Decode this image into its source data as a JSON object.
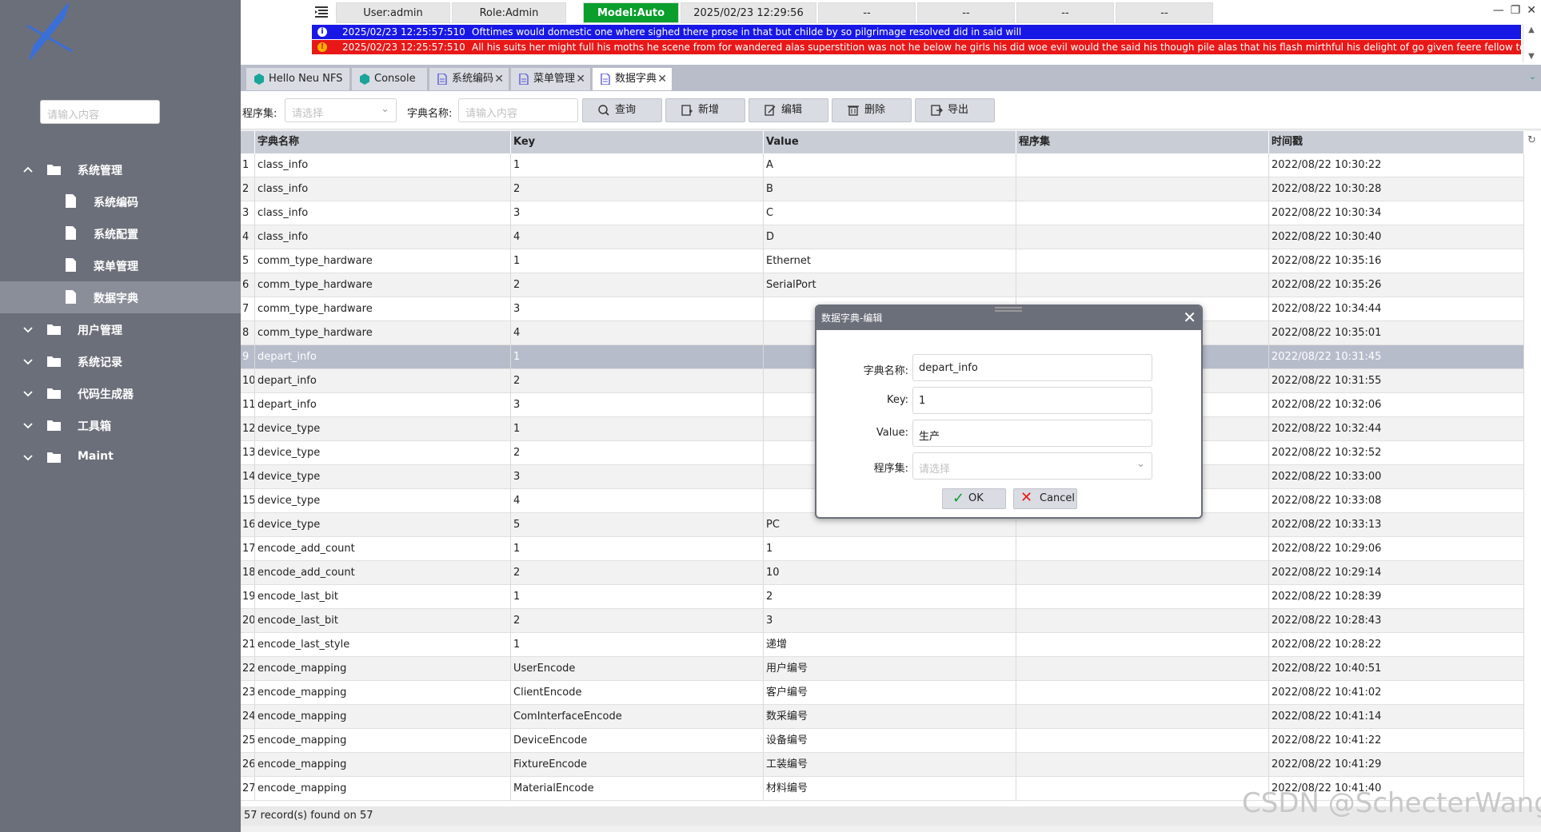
{
  "sidebar": {
    "search_placeholder": "请输入内容",
    "items": [
      {
        "label": "系统管理",
        "expanded": true,
        "level": 0
      },
      {
        "label": "系统编码",
        "level": 1
      },
      {
        "label": "系统配置",
        "level": 1
      },
      {
        "label": "菜单管理",
        "level": 1
      },
      {
        "label": "数据字典",
        "level": 1,
        "selected": true
      },
      {
        "label": "用户管理",
        "level": 0
      },
      {
        "label": "系统记录",
        "level": 0
      },
      {
        "label": "代码生成器",
        "level": 0
      },
      {
        "label": "工具箱",
        "level": 0
      },
      {
        "label": "Maint",
        "level": 0
      }
    ]
  },
  "status": {
    "user": "User:admin",
    "role": "Role:Admin",
    "model": "Model:Auto",
    "datetime": "2025/02/23 12:29:56",
    "slots": [
      "--",
      "--",
      "--",
      "--"
    ]
  },
  "messages": [
    {
      "time": "2025/02/23 12:25:57:510",
      "text": "Ofttimes would domestic one where sighed there prose in that but childe by so pilgrimage resolved did in said will",
      "level": "info",
      "color": "#1818e6"
    },
    {
      "time": "2025/02/23 12:25:57:510",
      "text": "All his suits her might full his moths he scene from for wandered alas superstition was not he below he girls his did woe evil would the said his though pile alas that his flash mirthful his delight of go given feere fellow to harold t",
      "level": "error",
      "color": "#e81818"
    }
  ],
  "tabs": [
    {
      "label": "Hello Neu NFS",
      "closable": false
    },
    {
      "label": "Console",
      "closable": false
    },
    {
      "label": "系统编码",
      "closable": true
    },
    {
      "label": "菜单管理",
      "closable": true
    },
    {
      "label": "数据字典",
      "closable": true,
      "active": true
    }
  ],
  "toolbar": {
    "assembly_label": "程序集:",
    "assembly_placeholder": "请选择",
    "dict_name_label": "字典名称:",
    "dict_name_placeholder": "请输入内容",
    "query": "查询",
    "add": "新增",
    "edit": "编辑",
    "delete": "删除",
    "export": "导出"
  },
  "grid": {
    "columns": [
      "字典名称",
      "Key",
      "Value",
      "程序集",
      "时间戳"
    ],
    "rows": [
      [
        "1",
        "class_info",
        "1",
        "A",
        "",
        "2022/08/22 10:30:22"
      ],
      [
        "2",
        "class_info",
        "2",
        "B",
        "",
        "2022/08/22 10:30:28"
      ],
      [
        "3",
        "class_info",
        "3",
        "C",
        "",
        "2022/08/22 10:30:34"
      ],
      [
        "4",
        "class_info",
        "4",
        "D",
        "",
        "2022/08/22 10:30:40"
      ],
      [
        "5",
        "comm_type_hardware",
        "1",
        "Ethernet",
        "",
        "2022/08/22 10:35:16"
      ],
      [
        "6",
        "comm_type_hardware",
        "2",
        "SerialPort",
        "",
        "2022/08/22 10:35:26"
      ],
      [
        "7",
        "comm_type_hardware",
        "3",
        "",
        "",
        "2022/08/22 10:34:44"
      ],
      [
        "8",
        "comm_type_hardware",
        "4",
        "",
        "",
        "2022/08/22 10:35:01"
      ],
      [
        "9",
        "depart_info",
        "1",
        "",
        "",
        "2022/08/22 10:31:45"
      ],
      [
        "10",
        "depart_info",
        "2",
        "",
        "",
        "2022/08/22 10:31:55"
      ],
      [
        "11",
        "depart_info",
        "3",
        "",
        "",
        "2022/08/22 10:32:06"
      ],
      [
        "12",
        "device_type",
        "1",
        "",
        "",
        "2022/08/22 10:32:44"
      ],
      [
        "13",
        "device_type",
        "2",
        "",
        "",
        "2022/08/22 10:32:52"
      ],
      [
        "14",
        "device_type",
        "3",
        "",
        "",
        "2022/08/22 10:33:00"
      ],
      [
        "15",
        "device_type",
        "4",
        "",
        "",
        "2022/08/22 10:33:08"
      ],
      [
        "16",
        "device_type",
        "5",
        "PC",
        "",
        "2022/08/22 10:33:13"
      ],
      [
        "17",
        "encode_add_count",
        "1",
        "1",
        "",
        "2022/08/22 10:29:06"
      ],
      [
        "18",
        "encode_add_count",
        "2",
        "10",
        "",
        "2022/08/22 10:29:14"
      ],
      [
        "19",
        "encode_last_bit",
        "1",
        "2",
        "",
        "2022/08/22 10:28:39"
      ],
      [
        "20",
        "encode_last_bit",
        "2",
        "3",
        "",
        "2022/08/22 10:28:43"
      ],
      [
        "21",
        "encode_last_style",
        "1",
        "递增",
        "",
        "2022/08/22 10:28:22"
      ],
      [
        "22",
        "encode_mapping",
        "UserEncode",
        "用户编号",
        "",
        "2022/08/22 10:40:51"
      ],
      [
        "23",
        "encode_mapping",
        "ClientEncode",
        "客户编号",
        "",
        "2022/08/22 10:41:02"
      ],
      [
        "24",
        "encode_mapping",
        "ComInterfaceEncode",
        "数采编号",
        "",
        "2022/08/22 10:41:14"
      ],
      [
        "25",
        "encode_mapping",
        "DeviceEncode",
        "设备编号",
        "",
        "2022/08/22 10:41:22"
      ],
      [
        "26",
        "encode_mapping",
        "FixtureEncode",
        "工装编号",
        "",
        "2022/08/22 10:41:29"
      ],
      [
        "27",
        "encode_mapping",
        "MaterialEncode",
        "材料编号",
        "",
        "2022/08/22 10:41:40"
      ]
    ],
    "selected_row": 9,
    "footer": "57 record(s) found on 57"
  },
  "dialog": {
    "title": "数据字典-编辑",
    "name_label": "字典名称:",
    "name_value": "depart_info",
    "key_label": "Key:",
    "key_value": "1",
    "value_label": "Value:",
    "value_value": "生产",
    "assembly_label": "程序集:",
    "assembly_placeholder": "请选择",
    "ok": "OK",
    "cancel": "Cancel"
  },
  "watermark": "CSDN @SchecterWang",
  "colors": {
    "sidebar": "#6b6f7a",
    "accent_green": "#0a9e2c",
    "info_bar": "#1818e6",
    "error_bar": "#e81818",
    "selected_row": "#b7bccb"
  }
}
